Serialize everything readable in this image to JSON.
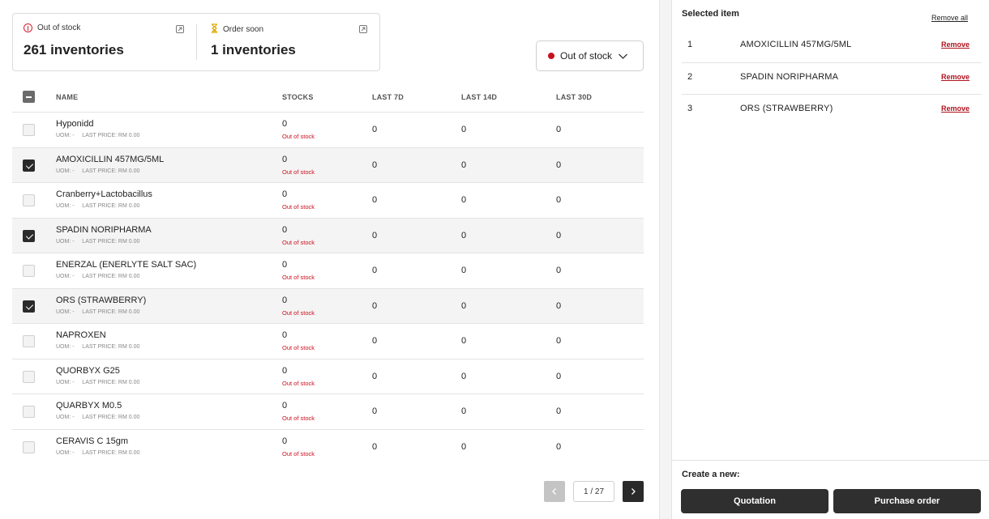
{
  "summary": {
    "out_of_stock": {
      "label": "Out of stock",
      "value": "261 inventories"
    },
    "order_soon": {
      "label": "Order soon",
      "value": "1 inventories"
    }
  },
  "filter": {
    "label": "Out of stock",
    "dot_color": "#c8101e"
  },
  "table": {
    "headers": {
      "name": "NAME",
      "stocks": "STOCKS",
      "last7": "LAST 7D",
      "last14": "LAST 14D",
      "last30": "LAST 30D"
    },
    "rows": [
      {
        "name": "Hyponidd",
        "uom": "UOM: -",
        "price": "LAST PRICE: RM 0.00",
        "stock": "0",
        "status": "Out of stock",
        "d7": "0",
        "d14": "0",
        "d30": "0",
        "checked": false
      },
      {
        "name": "AMOXICILLIN 457MG/5ML",
        "uom": "UOM: -",
        "price": "LAST PRICE: RM 0.00",
        "stock": "0",
        "status": "Out of stock",
        "d7": "0",
        "d14": "0",
        "d30": "0",
        "checked": true
      },
      {
        "name": "Cranberry+Lactobacillus",
        "uom": "UOM: -",
        "price": "LAST PRICE: RM 0.00",
        "stock": "0",
        "status": "Out of stock",
        "d7": "0",
        "d14": "0",
        "d30": "0",
        "checked": false
      },
      {
        "name": "SPADIN NORIPHARMA",
        "uom": "UOM: -",
        "price": "LAST PRICE: RM 0.00",
        "stock": "0",
        "status": "Out of stock",
        "d7": "0",
        "d14": "0",
        "d30": "0",
        "checked": true
      },
      {
        "name": "ENERZAL (ENERLYTE SALT SAC)",
        "uom": "UOM: -",
        "price": "LAST PRICE: RM 0.00",
        "stock": "0",
        "status": "Out of stock",
        "d7": "0",
        "d14": "0",
        "d30": "0",
        "checked": false
      },
      {
        "name": "ORS (STRAWBERRY)",
        "uom": "UOM: -",
        "price": "LAST PRICE: RM 0.00",
        "stock": "0",
        "status": "Out of stock",
        "d7": "0",
        "d14": "0",
        "d30": "0",
        "checked": true
      },
      {
        "name": "NAPROXEN",
        "uom": "UOM: -",
        "price": "LAST PRICE: RM 0.00",
        "stock": "0",
        "status": "Out of stock",
        "d7": "0",
        "d14": "0",
        "d30": "0",
        "checked": false
      },
      {
        "name": "QUORBYX G25",
        "uom": "UOM: -",
        "price": "LAST PRICE: RM 0.00",
        "stock": "0",
        "status": "Out of stock",
        "d7": "0",
        "d14": "0",
        "d30": "0",
        "checked": false
      },
      {
        "name": "QUARBYX M0.5",
        "uom": "UOM: -",
        "price": "LAST PRICE: RM 0.00",
        "stock": "0",
        "status": "Out of stock",
        "d7": "0",
        "d14": "0",
        "d30": "0",
        "checked": false
      },
      {
        "name": "CERAVIS C 15gm",
        "uom": "UOM: -",
        "price": "LAST PRICE: RM 0.00",
        "stock": "0",
        "status": "Out of stock",
        "d7": "0",
        "d14": "0",
        "d30": "0",
        "checked": false
      }
    ]
  },
  "pagination": {
    "page": "1 / 27"
  },
  "selected": {
    "title": "Selected item",
    "remove_all": "Remove all",
    "items": [
      {
        "index": "1",
        "name": "AMOXICILLIN 457MG/5ML",
        "remove": "Remove"
      },
      {
        "index": "2",
        "name": "SPADIN NORIPHARMA",
        "remove": "Remove"
      },
      {
        "index": "3",
        "name": "ORS (STRAWBERRY)",
        "remove": "Remove"
      }
    ]
  },
  "create": {
    "label": "Create a new:",
    "quotation": "Quotation",
    "purchase_order": "Purchase order"
  }
}
